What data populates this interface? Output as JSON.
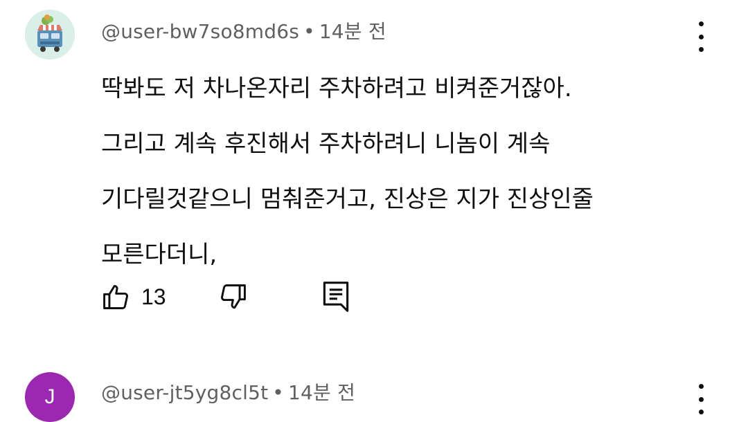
{
  "comments": [
    {
      "author": "@user-bw7so8md6s",
      "separator": "•",
      "time": "14분 전",
      "avatar": {
        "type": "image",
        "icon": "toaster-avatar-icon",
        "bg": "#d9efe7"
      },
      "lines": [
        "딱봐도 저 차나온자리 주차하려고 비켜준거잖아.",
        "그리고 계속 후진해서 주차하려니 니놈이 계속",
        "기다릴것같으니 멈춰준거고,  진상은 지가 진상인줄",
        "모른다더니,"
      ],
      "likes": "13"
    },
    {
      "author": "@user-jt5yg8cl5t",
      "separator": "•",
      "time": "14분 전",
      "avatar": {
        "type": "letter",
        "letter": "J",
        "bg": "#9c27b0"
      }
    }
  ],
  "colors": {
    "text": "#0f0f0f",
    "meta": "#606060"
  }
}
